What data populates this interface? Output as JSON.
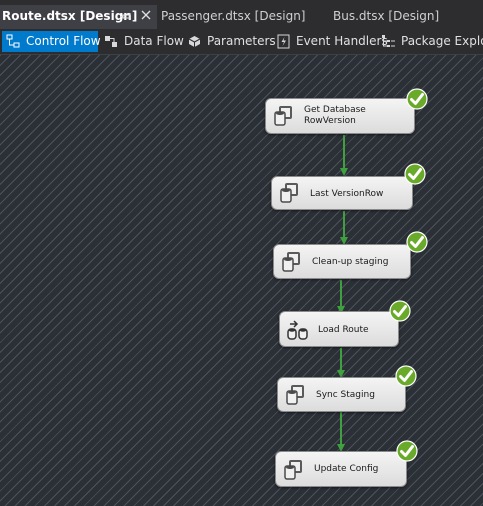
{
  "document_tabs": [
    {
      "label": "Route.dtsx [Design]",
      "active": true
    },
    {
      "label": "Passenger.dtsx [Design]",
      "active": false
    },
    {
      "label": "Bus.dtsx [Design]",
      "active": false
    }
  ],
  "designer_tabs": [
    {
      "label": "Control Flow",
      "icon": "control-flow-icon",
      "selected": true
    },
    {
      "label": "Data Flow",
      "icon": "data-flow-icon",
      "selected": false
    },
    {
      "label": "Parameters",
      "icon": "parameters-icon",
      "selected": false
    },
    {
      "label": "Event Handlers",
      "icon": "event-handlers-icon",
      "selected": false
    },
    {
      "label": "Package Explorer",
      "icon": "package-explorer-icon",
      "selected": false
    }
  ],
  "tasks": [
    {
      "label": "Get Database RowVersion",
      "icon": "execute-sql-task-icon",
      "status": "success"
    },
    {
      "label": "Last VersionRow",
      "icon": "execute-sql-task-icon",
      "status": "success"
    },
    {
      "label": "Clean-up staging",
      "icon": "execute-sql-task-icon",
      "status": "success"
    },
    {
      "label": "Load Route",
      "icon": "data-flow-task-icon",
      "status": "success"
    },
    {
      "label": "Sync Staging",
      "icon": "execute-sql-task-icon",
      "status": "success"
    },
    {
      "label": "Update Config",
      "icon": "execute-sql-task-icon",
      "status": "success"
    }
  ],
  "colors": {
    "accent": "#007acc",
    "success": "#6aaa2a",
    "connector": "#3ea03e"
  }
}
